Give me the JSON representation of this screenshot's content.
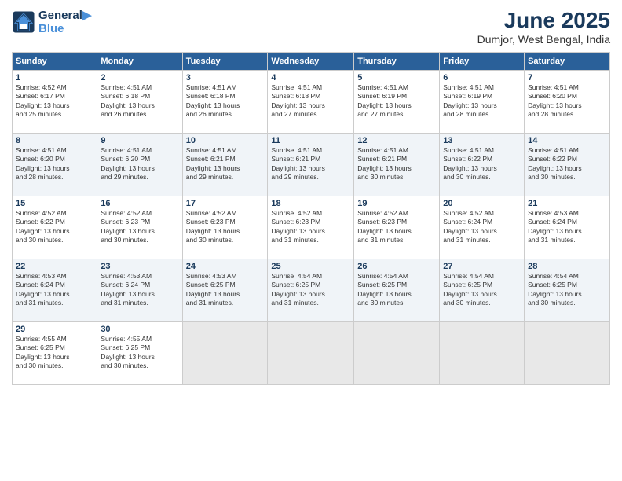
{
  "logo": {
    "line1": "General",
    "line2": "Blue"
  },
  "title": "June 2025",
  "location": "Dumjor, West Bengal, India",
  "headers": [
    "Sunday",
    "Monday",
    "Tuesday",
    "Wednesday",
    "Thursday",
    "Friday",
    "Saturday"
  ],
  "weeks": [
    [
      {
        "day": "1",
        "info": "Sunrise: 4:52 AM\nSunset: 6:17 PM\nDaylight: 13 hours\nand 25 minutes."
      },
      {
        "day": "2",
        "info": "Sunrise: 4:51 AM\nSunset: 6:18 PM\nDaylight: 13 hours\nand 26 minutes."
      },
      {
        "day": "3",
        "info": "Sunrise: 4:51 AM\nSunset: 6:18 PM\nDaylight: 13 hours\nand 26 minutes."
      },
      {
        "day": "4",
        "info": "Sunrise: 4:51 AM\nSunset: 6:18 PM\nDaylight: 13 hours\nand 27 minutes."
      },
      {
        "day": "5",
        "info": "Sunrise: 4:51 AM\nSunset: 6:19 PM\nDaylight: 13 hours\nand 27 minutes."
      },
      {
        "day": "6",
        "info": "Sunrise: 4:51 AM\nSunset: 6:19 PM\nDaylight: 13 hours\nand 28 minutes."
      },
      {
        "day": "7",
        "info": "Sunrise: 4:51 AM\nSunset: 6:20 PM\nDaylight: 13 hours\nand 28 minutes."
      }
    ],
    [
      {
        "day": "8",
        "info": "Sunrise: 4:51 AM\nSunset: 6:20 PM\nDaylight: 13 hours\nand 28 minutes."
      },
      {
        "day": "9",
        "info": "Sunrise: 4:51 AM\nSunset: 6:20 PM\nDaylight: 13 hours\nand 29 minutes."
      },
      {
        "day": "10",
        "info": "Sunrise: 4:51 AM\nSunset: 6:21 PM\nDaylight: 13 hours\nand 29 minutes."
      },
      {
        "day": "11",
        "info": "Sunrise: 4:51 AM\nSunset: 6:21 PM\nDaylight: 13 hours\nand 29 minutes."
      },
      {
        "day": "12",
        "info": "Sunrise: 4:51 AM\nSunset: 6:21 PM\nDaylight: 13 hours\nand 30 minutes."
      },
      {
        "day": "13",
        "info": "Sunrise: 4:51 AM\nSunset: 6:22 PM\nDaylight: 13 hours\nand 30 minutes."
      },
      {
        "day": "14",
        "info": "Sunrise: 4:51 AM\nSunset: 6:22 PM\nDaylight: 13 hours\nand 30 minutes."
      }
    ],
    [
      {
        "day": "15",
        "info": "Sunrise: 4:52 AM\nSunset: 6:22 PM\nDaylight: 13 hours\nand 30 minutes."
      },
      {
        "day": "16",
        "info": "Sunrise: 4:52 AM\nSunset: 6:23 PM\nDaylight: 13 hours\nand 30 minutes."
      },
      {
        "day": "17",
        "info": "Sunrise: 4:52 AM\nSunset: 6:23 PM\nDaylight: 13 hours\nand 30 minutes."
      },
      {
        "day": "18",
        "info": "Sunrise: 4:52 AM\nSunset: 6:23 PM\nDaylight: 13 hours\nand 31 minutes."
      },
      {
        "day": "19",
        "info": "Sunrise: 4:52 AM\nSunset: 6:23 PM\nDaylight: 13 hours\nand 31 minutes."
      },
      {
        "day": "20",
        "info": "Sunrise: 4:52 AM\nSunset: 6:24 PM\nDaylight: 13 hours\nand 31 minutes."
      },
      {
        "day": "21",
        "info": "Sunrise: 4:53 AM\nSunset: 6:24 PM\nDaylight: 13 hours\nand 31 minutes."
      }
    ],
    [
      {
        "day": "22",
        "info": "Sunrise: 4:53 AM\nSunset: 6:24 PM\nDaylight: 13 hours\nand 31 minutes."
      },
      {
        "day": "23",
        "info": "Sunrise: 4:53 AM\nSunset: 6:24 PM\nDaylight: 13 hours\nand 31 minutes."
      },
      {
        "day": "24",
        "info": "Sunrise: 4:53 AM\nSunset: 6:25 PM\nDaylight: 13 hours\nand 31 minutes."
      },
      {
        "day": "25",
        "info": "Sunrise: 4:54 AM\nSunset: 6:25 PM\nDaylight: 13 hours\nand 31 minutes."
      },
      {
        "day": "26",
        "info": "Sunrise: 4:54 AM\nSunset: 6:25 PM\nDaylight: 13 hours\nand 30 minutes."
      },
      {
        "day": "27",
        "info": "Sunrise: 4:54 AM\nSunset: 6:25 PM\nDaylight: 13 hours\nand 30 minutes."
      },
      {
        "day": "28",
        "info": "Sunrise: 4:54 AM\nSunset: 6:25 PM\nDaylight: 13 hours\nand 30 minutes."
      }
    ],
    [
      {
        "day": "29",
        "info": "Sunrise: 4:55 AM\nSunset: 6:25 PM\nDaylight: 13 hours\nand 30 minutes."
      },
      {
        "day": "30",
        "info": "Sunrise: 4:55 AM\nSunset: 6:25 PM\nDaylight: 13 hours\nand 30 minutes."
      },
      {
        "day": "",
        "info": ""
      },
      {
        "day": "",
        "info": ""
      },
      {
        "day": "",
        "info": ""
      },
      {
        "day": "",
        "info": ""
      },
      {
        "day": "",
        "info": ""
      }
    ]
  ]
}
